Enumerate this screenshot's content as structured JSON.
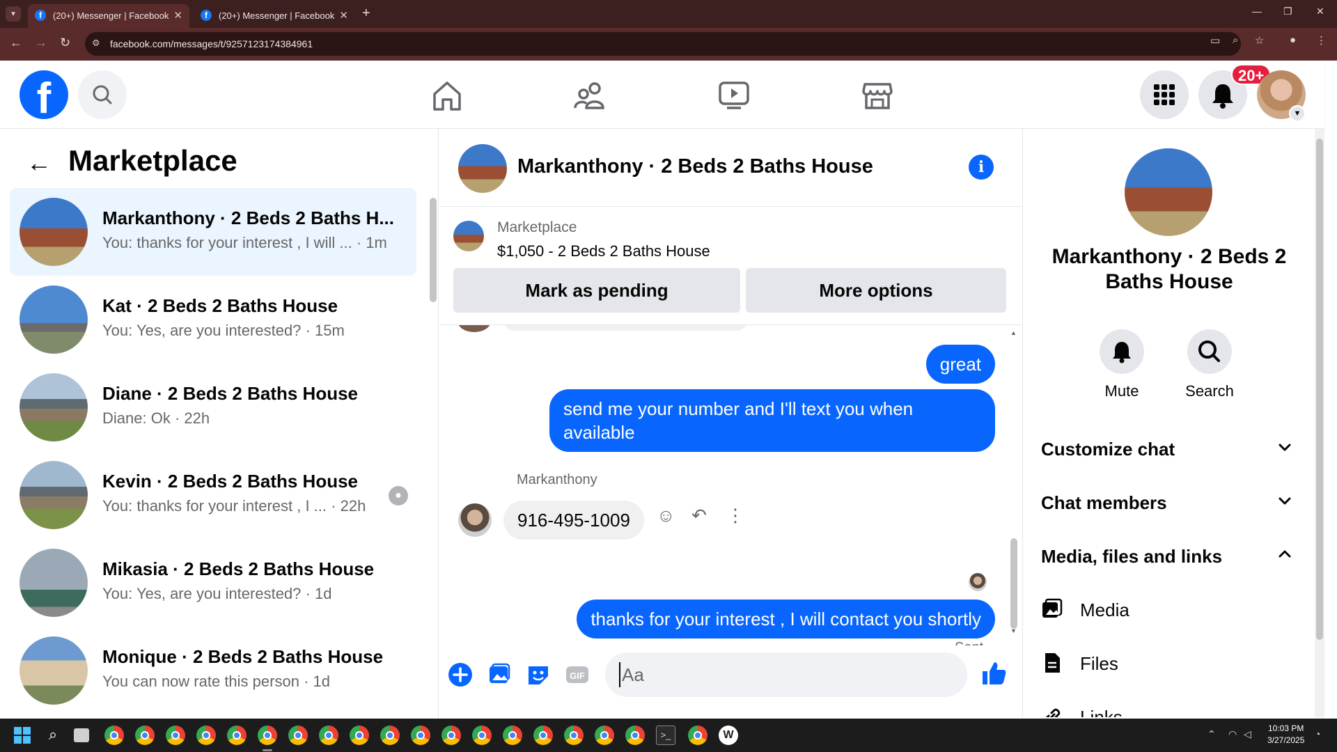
{
  "browser": {
    "tabs": [
      {
        "title": "(20+) Messenger | Facebook",
        "active": true
      },
      {
        "title": "(20+) Messenger | Facebook",
        "active": false
      }
    ],
    "url": "facebook.com/messages/t/9257123174384961"
  },
  "fb_nav": {
    "logo_letter": "f",
    "notification_badge": "20+"
  },
  "left_pane": {
    "title": "Marketplace",
    "conversations": [
      {
        "name": "Markanthony · 2 Beds 2 Baths H...",
        "preview": "You: thanks for your interest , I will ...",
        "time": "· 1m",
        "active": true
      },
      {
        "name": "Kat · 2 Beds 2 Baths House",
        "preview": "You: Yes, are you interested?",
        "time": "· 15m"
      },
      {
        "name": "Diane · 2 Beds 2 Baths House",
        "preview": "Diane: Ok",
        "time": "· 22h"
      },
      {
        "name": "Kevin · 2 Beds 2 Baths House",
        "preview": "You: thanks for your interest , I ...",
        "time": "· 22h"
      },
      {
        "name": "Mikasia · 2 Beds 2 Baths House",
        "preview": "You: Yes, are you interested?",
        "time": "· 1d"
      },
      {
        "name": "Monique · 2 Beds 2 Baths House",
        "preview": "You can now rate this person",
        "time": "· 1d"
      }
    ]
  },
  "conversation": {
    "title": "Markanthony · 2 Beds 2 Baths House",
    "marketplace_label": "Marketplace",
    "listing": "$1,050 - 2 Beds 2 Baths House",
    "mark_pending_label": "Mark as pending",
    "more_options_label": "More options",
    "messages": {
      "out_1": "great",
      "out_2": "send me your number and I'll text you when available",
      "sender_name": "Markanthony",
      "in_1": "916-495-1009",
      "out_3": "thanks for your interest , I will contact you shortly",
      "status": "Sent"
    },
    "composer_placeholder": "Aa"
  },
  "right_pane": {
    "name": "Markanthony · 2 Beds 2 Baths House",
    "mute_label": "Mute",
    "search_label": "Search",
    "sections": {
      "customize": "Customize chat",
      "members": "Chat members",
      "media_files_links": "Media, files and links"
    },
    "media_label": "Media",
    "files_label": "Files",
    "links_label": "Links"
  },
  "taskbar": {
    "time": "10:03 PM",
    "date": "3/27/2025"
  },
  "colors": {
    "fb_blue": "#0866ff",
    "badge_red": "#e41e3f",
    "chrome_dark": "#3c1f1f",
    "active_convo": "#ebf5ff"
  }
}
